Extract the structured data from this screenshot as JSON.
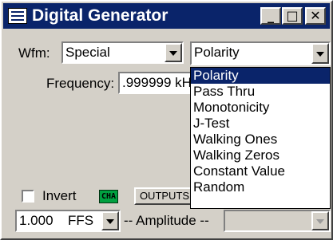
{
  "window": {
    "title": "Digital Generator",
    "icon": "generator-app-icon",
    "controls": {
      "minimize": "_",
      "maximize": "□",
      "close": "✕"
    },
    "accent": "#0a246a",
    "face": "#d4d0c8"
  },
  "waveform": {
    "label": "Wfm:",
    "value": "Special"
  },
  "mode_select": {
    "value": "Polarity"
  },
  "frequency": {
    "label": "Frequency:",
    "value": ".999999 kH"
  },
  "mode_list": {
    "options": [
      "Polarity",
      "Pass Thru",
      "Monotonicity",
      "J-Test",
      "Walking Ones",
      "Walking Zeros",
      "Constant Value",
      "Random"
    ],
    "selected_index": 0
  },
  "invert": {
    "label": "Invert",
    "checked": false
  },
  "channel_badge": {
    "text": "CHA",
    "color": "#00a040"
  },
  "outputs_button": {
    "label": "OUTPUTS"
  },
  "amplitude": {
    "value": "1.000",
    "unit": "FFS",
    "label": "-- Amplitude --"
  }
}
